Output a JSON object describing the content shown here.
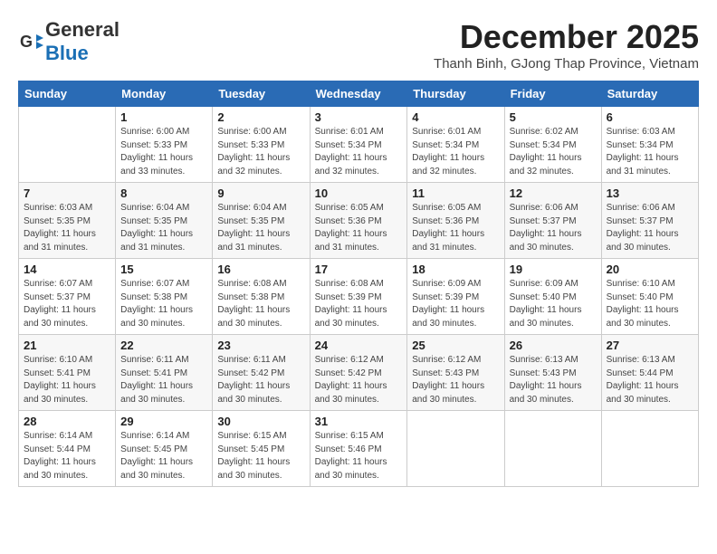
{
  "header": {
    "logo_general": "General",
    "logo_blue": "Blue",
    "month_title": "December 2025",
    "location": "Thanh Binh, GJong Thap Province, Vietnam"
  },
  "days_of_week": [
    "Sunday",
    "Monday",
    "Tuesday",
    "Wednesday",
    "Thursday",
    "Friday",
    "Saturday"
  ],
  "weeks": [
    [
      {
        "day": "",
        "info": ""
      },
      {
        "day": "1",
        "info": "Sunrise: 6:00 AM\nSunset: 5:33 PM\nDaylight: 11 hours\nand 33 minutes."
      },
      {
        "day": "2",
        "info": "Sunrise: 6:00 AM\nSunset: 5:33 PM\nDaylight: 11 hours\nand 32 minutes."
      },
      {
        "day": "3",
        "info": "Sunrise: 6:01 AM\nSunset: 5:34 PM\nDaylight: 11 hours\nand 32 minutes."
      },
      {
        "day": "4",
        "info": "Sunrise: 6:01 AM\nSunset: 5:34 PM\nDaylight: 11 hours\nand 32 minutes."
      },
      {
        "day": "5",
        "info": "Sunrise: 6:02 AM\nSunset: 5:34 PM\nDaylight: 11 hours\nand 32 minutes."
      },
      {
        "day": "6",
        "info": "Sunrise: 6:03 AM\nSunset: 5:34 PM\nDaylight: 11 hours\nand 31 minutes."
      }
    ],
    [
      {
        "day": "7",
        "info": "Sunrise: 6:03 AM\nSunset: 5:35 PM\nDaylight: 11 hours\nand 31 minutes."
      },
      {
        "day": "8",
        "info": "Sunrise: 6:04 AM\nSunset: 5:35 PM\nDaylight: 11 hours\nand 31 minutes."
      },
      {
        "day": "9",
        "info": "Sunrise: 6:04 AM\nSunset: 5:35 PM\nDaylight: 11 hours\nand 31 minutes."
      },
      {
        "day": "10",
        "info": "Sunrise: 6:05 AM\nSunset: 5:36 PM\nDaylight: 11 hours\nand 31 minutes."
      },
      {
        "day": "11",
        "info": "Sunrise: 6:05 AM\nSunset: 5:36 PM\nDaylight: 11 hours\nand 31 minutes."
      },
      {
        "day": "12",
        "info": "Sunrise: 6:06 AM\nSunset: 5:37 PM\nDaylight: 11 hours\nand 30 minutes."
      },
      {
        "day": "13",
        "info": "Sunrise: 6:06 AM\nSunset: 5:37 PM\nDaylight: 11 hours\nand 30 minutes."
      }
    ],
    [
      {
        "day": "14",
        "info": "Sunrise: 6:07 AM\nSunset: 5:37 PM\nDaylight: 11 hours\nand 30 minutes."
      },
      {
        "day": "15",
        "info": "Sunrise: 6:07 AM\nSunset: 5:38 PM\nDaylight: 11 hours\nand 30 minutes."
      },
      {
        "day": "16",
        "info": "Sunrise: 6:08 AM\nSunset: 5:38 PM\nDaylight: 11 hours\nand 30 minutes."
      },
      {
        "day": "17",
        "info": "Sunrise: 6:08 AM\nSunset: 5:39 PM\nDaylight: 11 hours\nand 30 minutes."
      },
      {
        "day": "18",
        "info": "Sunrise: 6:09 AM\nSunset: 5:39 PM\nDaylight: 11 hours\nand 30 minutes."
      },
      {
        "day": "19",
        "info": "Sunrise: 6:09 AM\nSunset: 5:40 PM\nDaylight: 11 hours\nand 30 minutes."
      },
      {
        "day": "20",
        "info": "Sunrise: 6:10 AM\nSunset: 5:40 PM\nDaylight: 11 hours\nand 30 minutes."
      }
    ],
    [
      {
        "day": "21",
        "info": "Sunrise: 6:10 AM\nSunset: 5:41 PM\nDaylight: 11 hours\nand 30 minutes."
      },
      {
        "day": "22",
        "info": "Sunrise: 6:11 AM\nSunset: 5:41 PM\nDaylight: 11 hours\nand 30 minutes."
      },
      {
        "day": "23",
        "info": "Sunrise: 6:11 AM\nSunset: 5:42 PM\nDaylight: 11 hours\nand 30 minutes."
      },
      {
        "day": "24",
        "info": "Sunrise: 6:12 AM\nSunset: 5:42 PM\nDaylight: 11 hours\nand 30 minutes."
      },
      {
        "day": "25",
        "info": "Sunrise: 6:12 AM\nSunset: 5:43 PM\nDaylight: 11 hours\nand 30 minutes."
      },
      {
        "day": "26",
        "info": "Sunrise: 6:13 AM\nSunset: 5:43 PM\nDaylight: 11 hours\nand 30 minutes."
      },
      {
        "day": "27",
        "info": "Sunrise: 6:13 AM\nSunset: 5:44 PM\nDaylight: 11 hours\nand 30 minutes."
      }
    ],
    [
      {
        "day": "28",
        "info": "Sunrise: 6:14 AM\nSunset: 5:44 PM\nDaylight: 11 hours\nand 30 minutes."
      },
      {
        "day": "29",
        "info": "Sunrise: 6:14 AM\nSunset: 5:45 PM\nDaylight: 11 hours\nand 30 minutes."
      },
      {
        "day": "30",
        "info": "Sunrise: 6:15 AM\nSunset: 5:45 PM\nDaylight: 11 hours\nand 30 minutes."
      },
      {
        "day": "31",
        "info": "Sunrise: 6:15 AM\nSunset: 5:46 PM\nDaylight: 11 hours\nand 30 minutes."
      },
      {
        "day": "",
        "info": ""
      },
      {
        "day": "",
        "info": ""
      },
      {
        "day": "",
        "info": ""
      }
    ]
  ]
}
